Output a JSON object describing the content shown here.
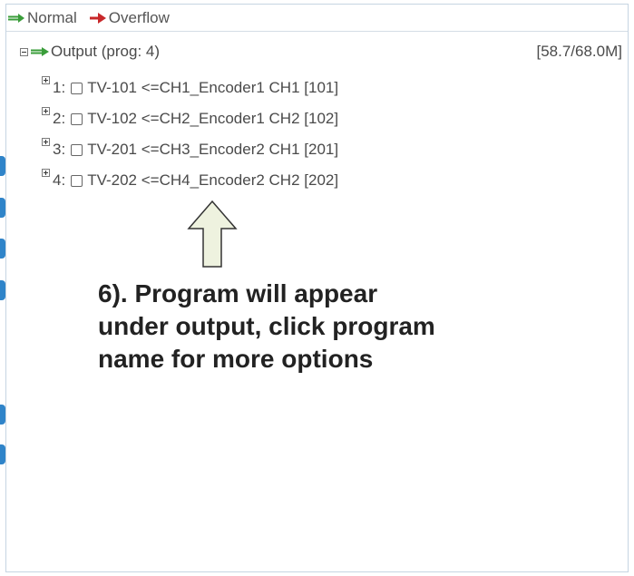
{
  "legend": {
    "normal_label": "Normal",
    "overflow_label": "Overflow",
    "normal_color": "#3a9d3a",
    "overflow_color": "#c8282a"
  },
  "output": {
    "label": "Output (prog: 4)",
    "bitrate": "[58.7/68.0M]",
    "programs": [
      {
        "index": "1:",
        "name": "TV-101 <=CH1_Encoder1 CH1 [101]"
      },
      {
        "index": "2:",
        "name": "TV-102 <=CH2_Encoder1 CH2 [102]"
      },
      {
        "index": "3:",
        "name": "TV-201 <=CH3_Encoder2 CH1 [201]"
      },
      {
        "index": "4:",
        "name": "TV-202 <=CH4_Encoder2 CH2 [202]"
      }
    ]
  },
  "annotation": {
    "text": "6). Program will appear under output, click program name for more options"
  },
  "colors": {
    "side_tab": "#2f84c9",
    "arrow_fill": "#eef2df"
  }
}
